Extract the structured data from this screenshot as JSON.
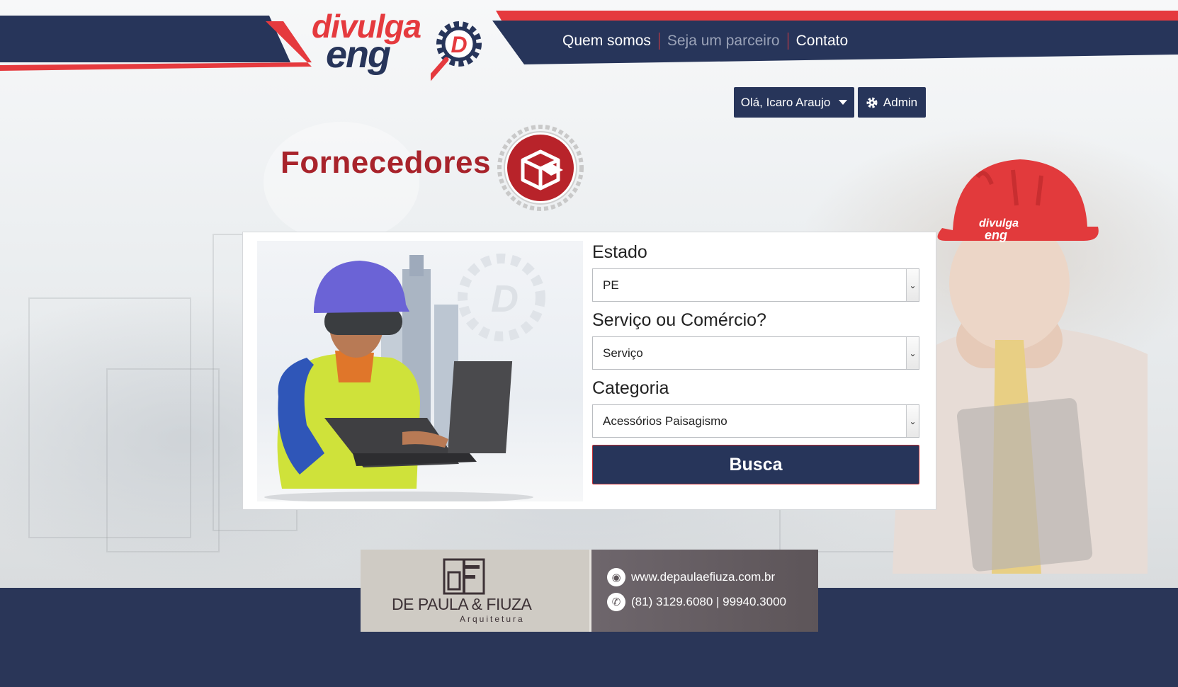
{
  "nav": {
    "items": [
      {
        "label": "Quem somos",
        "muted": false
      },
      {
        "label": "Seja um parceiro",
        "muted": true
      },
      {
        "label": "Contato",
        "muted": false
      }
    ]
  },
  "logo": {
    "line1": "divulga",
    "line2": "eng",
    "badge": "D"
  },
  "user": {
    "greeting": "Olá, Icaro Araujo",
    "admin_label": "Admin"
  },
  "page": {
    "title": "Fornecedores"
  },
  "form": {
    "estado_label": "Estado",
    "estado_value": "PE",
    "tipo_label": "Serviço ou Comércio?",
    "tipo_value": "Serviço",
    "categoria_label": "Categoria",
    "categoria_value": "Acessórios Paisagismo",
    "submit_label": "Busca"
  },
  "ad": {
    "brand": "DE PAULA & FIUZA",
    "sub": "Arquitetura",
    "website": "www.depaulaefiuza.com.br",
    "phone": "(81) 3129.6080 | 99940.3000"
  },
  "colors": {
    "navy": "#27355a",
    "red": "#e53a3e",
    "title_red": "#a8232b"
  }
}
